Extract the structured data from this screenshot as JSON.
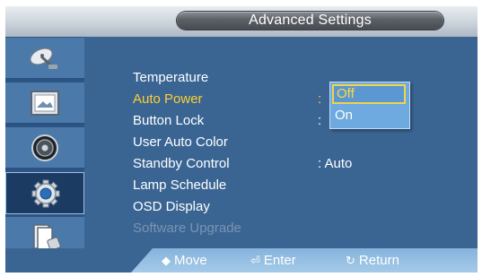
{
  "title": "Advanced Settings",
  "sidebar": {
    "items": [
      {
        "icon": "satellite-dish-icon"
      },
      {
        "icon": "picture-icon"
      },
      {
        "icon": "speaker-icon"
      },
      {
        "icon": "gear-icon",
        "active": true
      },
      {
        "icon": "support-book-icon"
      }
    ]
  },
  "menu": {
    "items": [
      {
        "label": "Temperature"
      },
      {
        "label": "Auto Power",
        "selected": true,
        "value": ":"
      },
      {
        "label": "Button Lock",
        "value": ":"
      },
      {
        "label": "User Auto Color"
      },
      {
        "label": "Standby Control",
        "value": ": Auto"
      },
      {
        "label": "Lamp Schedule"
      },
      {
        "label": "OSD Display"
      },
      {
        "label": "Software Upgrade",
        "disabled": true
      }
    ]
  },
  "dropdown": {
    "options": [
      "Off",
      "On"
    ],
    "selected": "Off"
  },
  "help": {
    "move": "Move",
    "enter": "Enter",
    "return": "Return"
  },
  "colors": {
    "background": "#3a6593",
    "selected_text": "#ffcf33",
    "dropdown": "#6ea9df"
  }
}
